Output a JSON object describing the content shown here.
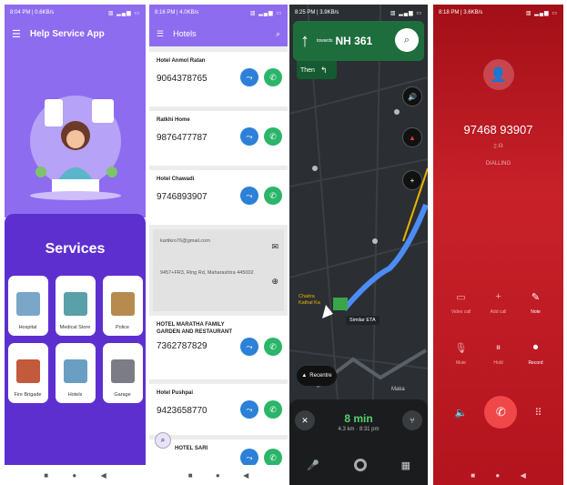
{
  "panel1": {
    "status_time": "8:04 PM | 0.6KB/s",
    "status_right": "▥ ▂▄▆ ▭",
    "menu_icon": "menu-icon",
    "app_title": "Help Service App",
    "services_title": "Services",
    "services": [
      {
        "label": "Hospital",
        "color": "#7aa6c8"
      },
      {
        "label": "Medical Store",
        "color": "#5aa0a8"
      },
      {
        "label": "Police",
        "color": "#b78a4d"
      },
      {
        "label": "Fire Brigade",
        "color": "#c25a3b"
      },
      {
        "label": "Hotels",
        "color": "#6a9ec2"
      },
      {
        "label": "Garage",
        "color": "#7b7c85"
      }
    ]
  },
  "panel2": {
    "status_time": "8:16 PM | 4.0KB/s",
    "title": "Hotels",
    "hotels": [
      {
        "name": "Hotel Anmol Ratan",
        "phone": "9064378765"
      },
      {
        "name": "Ratkhi Home",
        "phone": "9876477787"
      },
      {
        "name": "Hotel Chawadi",
        "phone": "9746893907"
      }
    ],
    "detail_email": "kartikro76@gmail.com",
    "detail_address": "9457+FR3, Ring Rd, Maharashtra 445002",
    "hotels2": [
      {
        "name": "HOTEL MARATHA FAMILY GARDEN AND RESTAURANT",
        "phone": "7362787829"
      },
      {
        "name": "Hotel Pushpai",
        "phone": "9423658770"
      },
      {
        "name": "HOTEL SARI",
        "phone": ""
      }
    ]
  },
  "panel3": {
    "status_time": "8:25 PM | 3.9KB/s",
    "towards": "towards",
    "road": "NH 361",
    "then": "Then",
    "similar": "Similar ETA",
    "place1": "Chaitra",
    "place2": "Kathal Ka",
    "recentre": "Recentre",
    "eta_min": "8 min",
    "eta_detail": "4.3 km · 8:31 pm",
    "side_label": "Maka"
  },
  "panel4": {
    "status_time": "8:18 PM | 3.6KB/s",
    "number": "97468 93907",
    "dialing": "DIALLING",
    "actions": [
      {
        "label": "Video call",
        "icon": "video-icon"
      },
      {
        "label": "Add call",
        "icon": "add-icon"
      },
      {
        "label": "Note",
        "icon": "note-icon"
      },
      {
        "label": "Mute",
        "icon": "mute-icon"
      },
      {
        "label": "Hold",
        "icon": "hold-icon"
      },
      {
        "label": "Record",
        "icon": "record-icon"
      }
    ]
  }
}
